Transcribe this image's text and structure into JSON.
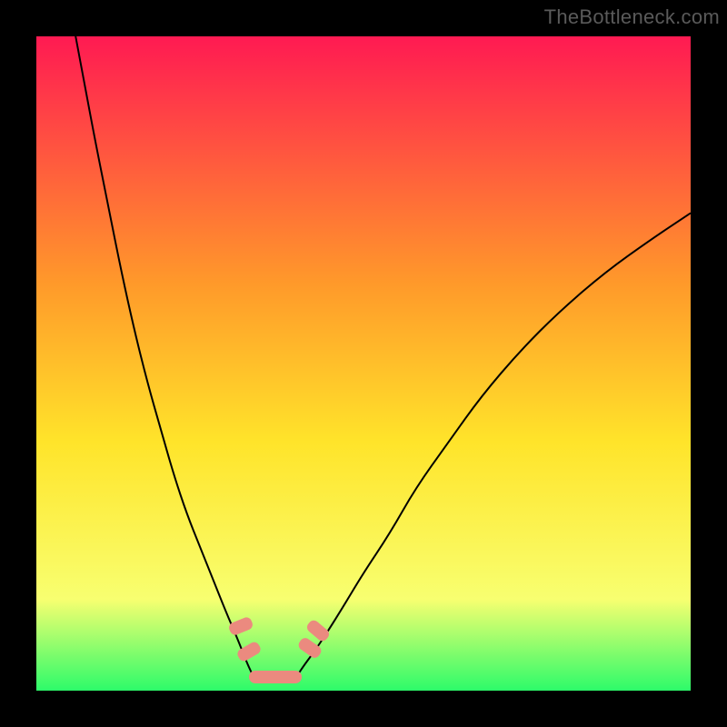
{
  "watermark": "TheBottleneck.com",
  "colors": {
    "background_black": "#000000",
    "gradient_top": "#ff1a52",
    "gradient_mid1": "#ff9a2a",
    "gradient_mid2": "#ffe42a",
    "gradient_mid3": "#f8ff70",
    "gradient_bottom": "#2dfb6a",
    "curve_stroke": "#000000",
    "bead": "#eb8a7f"
  },
  "chart_data": {
    "type": "line",
    "title": "",
    "xlabel": "",
    "ylabel": "",
    "xlim": [
      0,
      100
    ],
    "ylim": [
      0,
      100
    ],
    "series": [
      {
        "name": "left-branch",
        "x": [
          6,
          7.5,
          9,
          11,
          13,
          15,
          17,
          19,
          21,
          23,
          25,
          27,
          29,
          30.5,
          31.5,
          32.3,
          33
        ],
        "y": [
          100,
          92,
          84,
          74,
          64,
          55,
          47,
          40,
          33,
          27,
          22,
          17,
          12,
          8.5,
          6,
          4,
          2.5
        ]
      },
      {
        "name": "right-branch",
        "x": [
          40,
          41,
          42.5,
          44.5,
          47,
          50,
          54,
          58,
          63,
          68,
          74,
          80,
          87,
          94,
          100
        ],
        "y": [
          2.5,
          4,
          6,
          9,
          13,
          18,
          24,
          31,
          38,
          45,
          52,
          58,
          64,
          69,
          73
        ]
      }
    ],
    "optimal_zone_x": [
      33,
      40
    ],
    "beads": [
      {
        "x": 31.2,
        "y": 9.8,
        "angle": 68
      },
      {
        "x": 32.5,
        "y": 6.0,
        "angle": 60
      },
      {
        "x": 41.8,
        "y": 6.5,
        "angle": -55
      },
      {
        "x": 43.0,
        "y": 9.2,
        "angle": -50
      }
    ],
    "gradient_stops_percent_from_top": [
      {
        "pct": 0,
        "color_key": "gradient_top"
      },
      {
        "pct": 38,
        "color_key": "gradient_mid1"
      },
      {
        "pct": 62,
        "color_key": "gradient_mid2"
      },
      {
        "pct": 86,
        "color_key": "gradient_mid3"
      },
      {
        "pct": 100,
        "color_key": "gradient_bottom"
      }
    ]
  }
}
